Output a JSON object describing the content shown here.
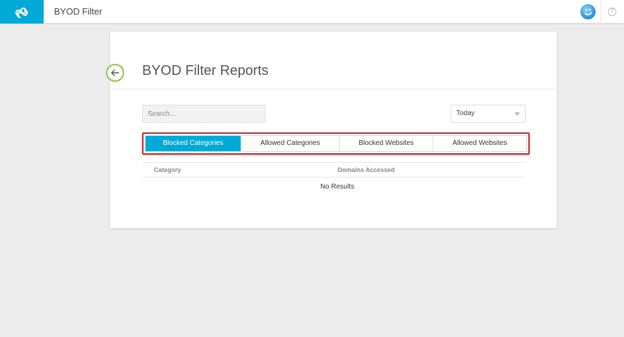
{
  "app": {
    "title": "BYOD Filter",
    "logo_icon": "infinity-loop-logo-icon",
    "brand_color": "#00a9d6"
  },
  "header": {
    "avatar_icon": "smiley-avatar-icon",
    "help_label": "?"
  },
  "page": {
    "title": "BYOD Filter Reports",
    "back_icon": "arrow-left-icon",
    "accent_color": "#8dc63f"
  },
  "filters": {
    "search_placeholder": "Search...",
    "date_range": {
      "selected": "Today"
    }
  },
  "tabs": [
    {
      "label": "Blocked Categories",
      "active": true
    },
    {
      "label": "Allowed Categories",
      "active": false
    },
    {
      "label": "Blocked Websites",
      "active": false
    },
    {
      "label": "Allowed Websites",
      "active": false
    }
  ],
  "highlight_color": "#c0272d",
  "table": {
    "columns": [
      "Category",
      "Domains Accessed"
    ],
    "empty_message": "No Results"
  }
}
